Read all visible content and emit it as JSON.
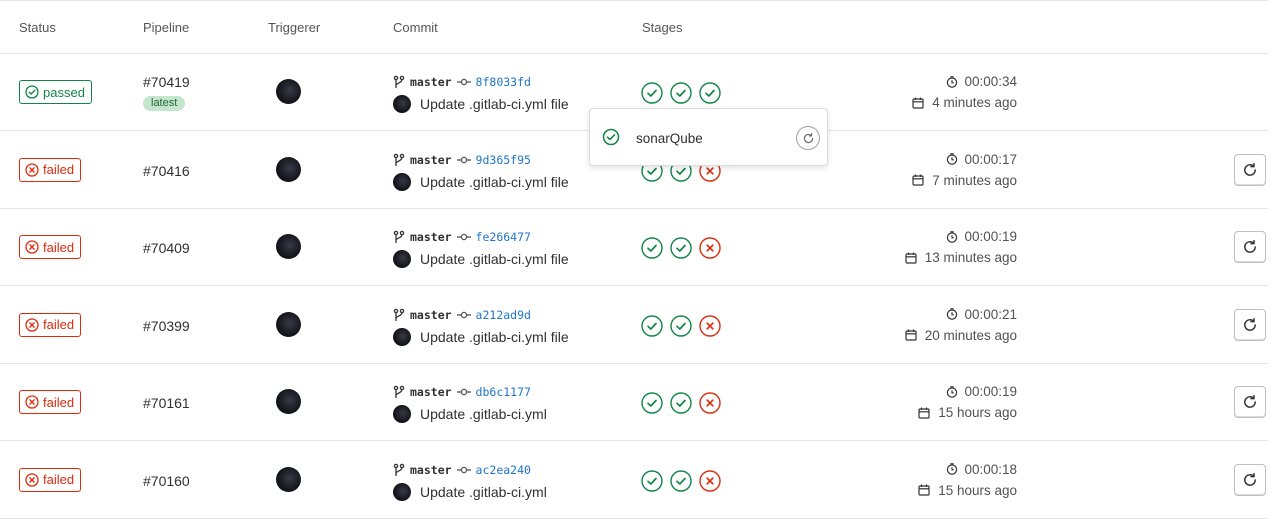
{
  "headers": {
    "status": "Status",
    "pipeline": "Pipeline",
    "triggerer": "Triggerer",
    "commit": "Commit",
    "stages": "Stages"
  },
  "colors": {
    "success": "#108548",
    "failed": "#dd2b0e",
    "link": "#1f75cb"
  },
  "rows": [
    {
      "status": "passed",
      "status_label": "passed",
      "pipeline_id": "#70419",
      "latest": "latest",
      "branch": "master",
      "sha": "8f8033fd",
      "commit_title": "Update .gitlab-ci.yml file",
      "stages": [
        "success",
        "success",
        "success"
      ],
      "duration": "00:00:34",
      "finished": "4 minutes ago",
      "retry": false
    },
    {
      "status": "failed",
      "status_label": "failed",
      "pipeline_id": "#70416",
      "branch": "master",
      "sha": "9d365f95",
      "commit_title": "Update .gitlab-ci.yml file",
      "stages": [
        "success",
        "success",
        "failed"
      ],
      "duration": "00:00:17",
      "finished": "7 minutes ago",
      "retry": true
    },
    {
      "status": "failed",
      "status_label": "failed",
      "pipeline_id": "#70409",
      "branch": "master",
      "sha": "fe266477",
      "commit_title": "Update .gitlab-ci.yml file",
      "stages": [
        "success",
        "success",
        "failed"
      ],
      "duration": "00:00:19",
      "finished": "13 minutes ago",
      "retry": true
    },
    {
      "status": "failed",
      "status_label": "failed",
      "pipeline_id": "#70399",
      "branch": "master",
      "sha": "a212ad9d",
      "commit_title": "Update .gitlab-ci.yml file",
      "stages": [
        "success",
        "success",
        "failed"
      ],
      "duration": "00:00:21",
      "finished": "20 minutes ago",
      "retry": true
    },
    {
      "status": "failed",
      "status_label": "failed",
      "pipeline_id": "#70161",
      "branch": "master",
      "sha": "db6c1177",
      "commit_title": "Update .gitlab-ci.yml",
      "stages": [
        "success",
        "success",
        "failed"
      ],
      "duration": "00:00:19",
      "finished": "15 hours ago",
      "retry": true
    },
    {
      "status": "failed",
      "status_label": "failed",
      "pipeline_id": "#70160",
      "branch": "master",
      "sha": "ac2ea240",
      "commit_title": "Update .gitlab-ci.yml",
      "stages": [
        "success",
        "success",
        "failed"
      ],
      "duration": "00:00:18",
      "finished": "15 hours ago",
      "retry": true
    }
  ],
  "stage_dropdown": {
    "job_name": "sonarQube",
    "job_status": "success"
  }
}
